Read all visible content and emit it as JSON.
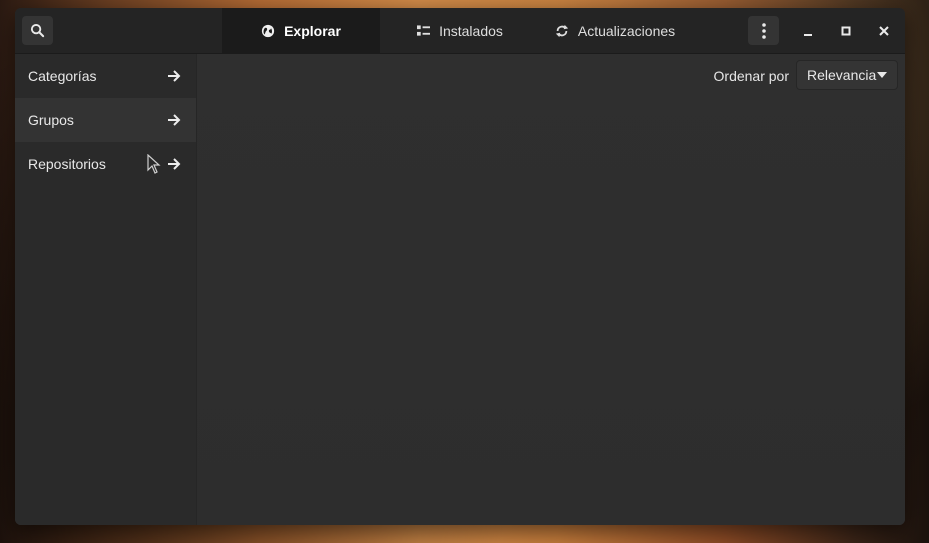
{
  "tabs": [
    {
      "label": "Explorar",
      "icon": "globe-icon",
      "active": true
    },
    {
      "label": "Instalados",
      "icon": "list-icon",
      "active": false
    },
    {
      "label": "Actualizaciones",
      "icon": "refresh-icon",
      "active": false
    }
  ],
  "sidebar": {
    "items": [
      {
        "label": "Categorías",
        "icon": "arrow-right-icon"
      },
      {
        "label": "Grupos",
        "icon": "arrow-right-icon"
      },
      {
        "label": "Repositorios",
        "icon": "arrow-right-icon"
      }
    ]
  },
  "sort": {
    "label": "Ordenar por",
    "selected": "Relevancia"
  },
  "colors": {
    "window_bg": "#2f2f2f",
    "headerbar_bg": "#242424",
    "active_tab_bg": "#1b1b1b",
    "sidebar_bg": "#2a2a2a",
    "text": "#e8e8e8"
  }
}
